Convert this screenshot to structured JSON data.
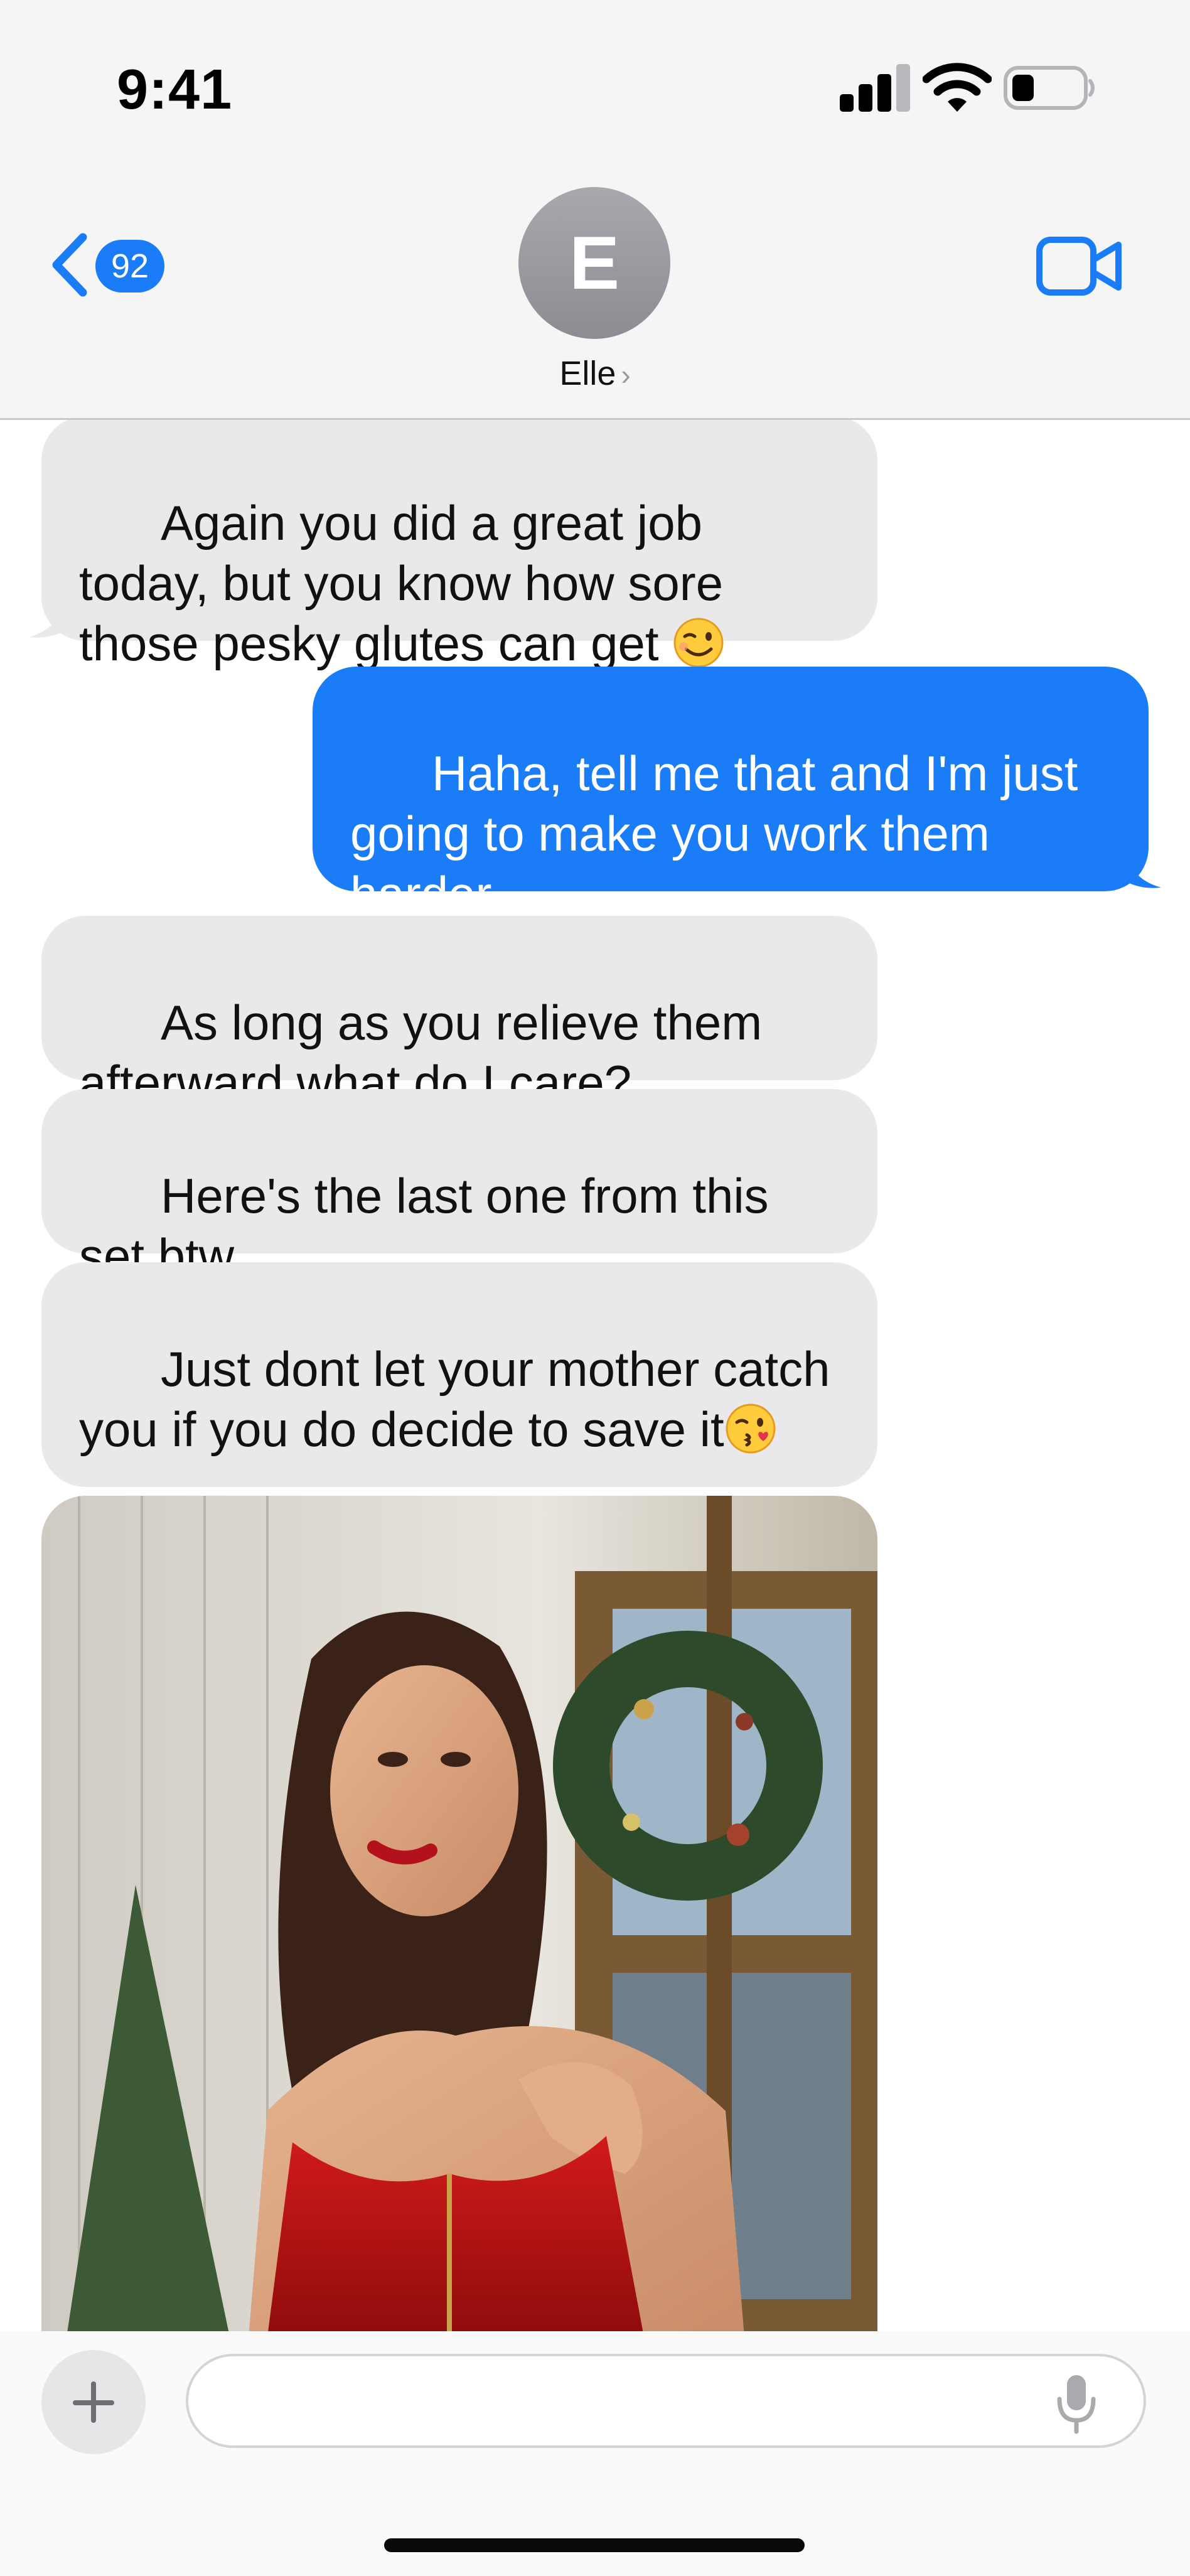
{
  "status_bar": {
    "time": "9:41"
  },
  "header": {
    "unread_count": "92",
    "avatar_initial": "E",
    "contact_name": "Elle",
    "name_chevron": "›"
  },
  "messages": [
    {
      "from": "them",
      "text": "Again you did a great job today, but you know how sore those pesky glutes can get ",
      "emoji": "winking-face"
    },
    {
      "from": "me",
      "text": "Haha, tell me that and I'm just going to make you work them harder"
    },
    {
      "from": "them",
      "text": "As long as you relieve them afterward what do I care?"
    },
    {
      "from": "them",
      "text": "Here's the last one from this set btw"
    },
    {
      "from": "them",
      "text": "Just dont let your mother catch you if you do decide to save it",
      "emoji": "face-blowing-kiss"
    },
    {
      "from": "them",
      "type": "photo"
    }
  ],
  "composer": {
    "placeholder": ""
  },
  "colors": {
    "accent": "#1a7cf6",
    "incoming_bubble": "#e9e9eb",
    "header_bg": "#f5f5f5"
  }
}
